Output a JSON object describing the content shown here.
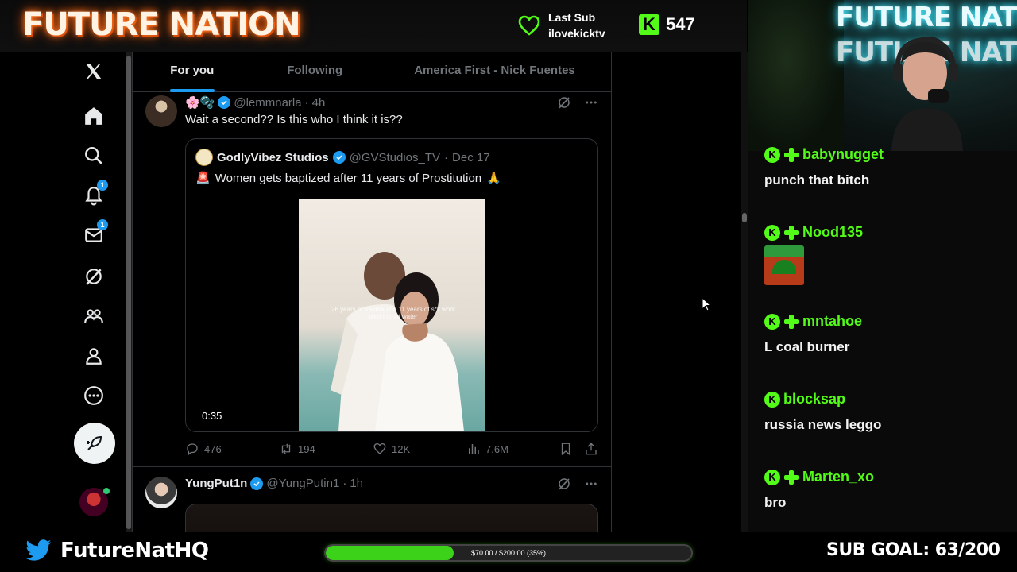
{
  "overlay": {
    "brand": "FUTURE NATION",
    "last_sub_label": "Last Sub",
    "last_sub_user": "ilovekicktv",
    "kick_logo": "K",
    "viewer_count": "547"
  },
  "sidebar": {
    "items": [
      {
        "name": "x-logo-icon"
      },
      {
        "name": "home-icon"
      },
      {
        "name": "search-icon"
      },
      {
        "name": "notifications-icon",
        "badge": "1"
      },
      {
        "name": "messages-icon",
        "badge": "1"
      },
      {
        "name": "grok-icon"
      },
      {
        "name": "communities-icon"
      },
      {
        "name": "profile-icon"
      },
      {
        "name": "more-icon"
      }
    ]
  },
  "tabs": [
    "For you",
    "Following",
    "America First - Nick Fuentes"
  ],
  "tweet1": {
    "emoji": "🌸🫧",
    "handle": "@lemmnarla",
    "time": "4h",
    "text": "Wait a second?? Is this who I think it is??",
    "quote": {
      "name": "GodlyVibez Studios",
      "handle": "@GVStudios_TV",
      "date": "Dec 17",
      "emoji_lead": "🚨",
      "text": "Women gets baptized after 11 years of Prostitution",
      "emoji_tail": "🙏",
      "video_caption": "26 years of trauma and 11 years of s*x work died in that water",
      "duration": "0:35"
    },
    "replies": "476",
    "reposts": "194",
    "likes": "12K",
    "views": "7.6M"
  },
  "tweet2": {
    "name": "YungPut1n",
    "handle": "@YungPutin1",
    "time": "1h"
  },
  "chat": {
    "messages": [
      {
        "user": "babynugget",
        "text": "punch that bitch"
      },
      {
        "user": "Nood135",
        "text": ""
      },
      {
        "user": "mntahoe",
        "text": "L coal burner"
      },
      {
        "user": "blocksap",
        "text": "russia news leggo"
      },
      {
        "user": "Marten_xo",
        "text": "bro"
      }
    ],
    "kick_badge": "K"
  },
  "bottom": {
    "twitter_handle": "FutureNatHQ",
    "goal_text": "$70.00 / $200.00 (35%)",
    "goal_progress": 0.35,
    "sub_goal": "SUB GOAL: 63/200"
  },
  "colors": {
    "kick_green": "#53fc18",
    "x_blue": "#1d9bf0"
  }
}
